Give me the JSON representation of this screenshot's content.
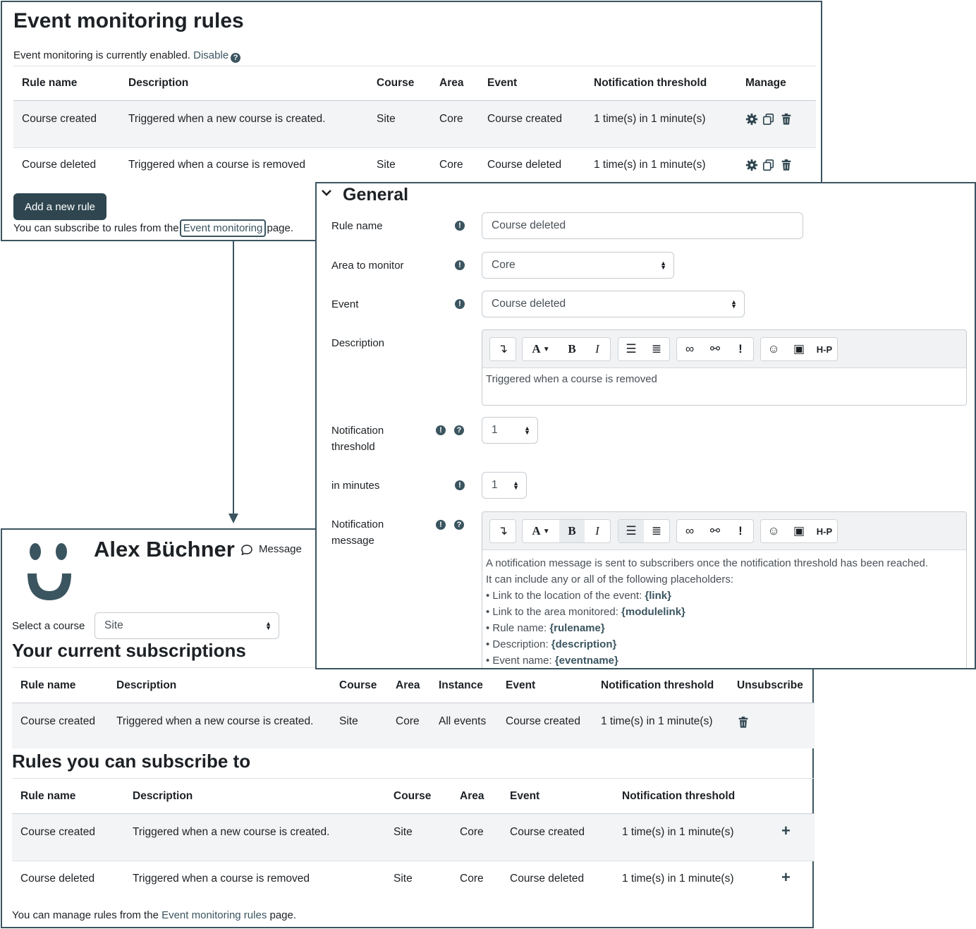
{
  "monitor": {
    "title": "Event monitoring rules",
    "status_text": "Event monitoring is currently enabled.",
    "disable_link": "Disable",
    "columns": [
      "Rule name",
      "Description",
      "Course",
      "Area",
      "Event",
      "Notification threshold",
      "Manage"
    ],
    "rows": [
      [
        "Course created",
        "Triggered when a new course is created.",
        "Site",
        "Core",
        "Course created",
        "1 time(s) in 1 minute(s)"
      ],
      [
        "Course deleted",
        "Triggered when a course is removed",
        "Site",
        "Core",
        "Course deleted",
        "1 time(s) in 1 minute(s)"
      ]
    ],
    "add_button": "Add a new rule",
    "subscribe_text_before": "You can subscribe to rules from the",
    "subscribe_link": "Event monitoring",
    "subscribe_text_after": "page."
  },
  "general": {
    "section_title": "General",
    "rule_name_label": "Rule name",
    "rule_name_value": "Course deleted",
    "area_label": "Area to monitor",
    "area_value": "Core",
    "event_label": "Event",
    "event_value": "Course deleted",
    "description_label": "Description",
    "description_value": "Triggered when a course is removed",
    "threshold_label_1": "Notification",
    "threshold_label_2": "threshold",
    "threshold_value": "1",
    "minutes_label": "in minutes",
    "minutes_value": "1",
    "message_label_1": "Notification",
    "message_label_2": "message",
    "message_line_1": "A notification message is sent to subscribers once the notification threshold has been reached.",
    "message_line_2": "It can include any or all of the following placeholders:",
    "placeholders": [
      {
        "text": "Link to the location of the event:",
        "code": "{link}"
      },
      {
        "text": "Link to the area monitored:",
        "code": "{modulelink}"
      },
      {
        "text": "Rule name:",
        "code": "{rulename}"
      },
      {
        "text": "Description:",
        "code": "{description}"
      },
      {
        "text": "Event name:",
        "code": "{eventname}"
      }
    ],
    "toolbar_labels": {
      "font": "A",
      "bold": "B",
      "italic": "I",
      "warn": "!",
      "h5p": "H-P"
    }
  },
  "subs": {
    "user_name": "Alex Büchner",
    "message_link": "Message",
    "select_label": "Select a course",
    "select_value": "Site",
    "current_title": "Your current subscriptions",
    "current_columns": [
      "Rule name",
      "Description",
      "Course",
      "Area",
      "Instance",
      "Event",
      "Notification threshold",
      "Unsubscribe"
    ],
    "current_rows": [
      [
        "Course created",
        "Triggered when a new course is created.",
        "Site",
        "Core",
        "All events",
        "Course created",
        "1 time(s) in 1 minute(s)"
      ]
    ],
    "available_title": "Rules you can subscribe to",
    "available_columns": [
      "Rule name",
      "Description",
      "Course",
      "Area",
      "Event",
      "Notification threshold"
    ],
    "available_rows": [
      [
        "Course created",
        "Triggered when a new course is created.",
        "Site",
        "Core",
        "Course created",
        "1 time(s) in 1 minute(s)"
      ],
      [
        "Course deleted",
        "Triggered when a course is removed",
        "Site",
        "Core",
        "Course deleted",
        "1 time(s) in 1 minute(s)"
      ]
    ],
    "footer_before": "You can manage rules from the",
    "footer_link": "Event monitoring rules",
    "footer_after": "page."
  },
  "colors": {
    "accent": "#3b5560",
    "button": "#2f4650",
    "stripe": "#f3f4f5"
  },
  "icons": [
    "help-icon",
    "gear-icon",
    "copy-icon",
    "trash-icon",
    "chevron-down-icon",
    "message-icon",
    "plus-icon",
    "info-icon",
    "avatar-icon"
  ]
}
